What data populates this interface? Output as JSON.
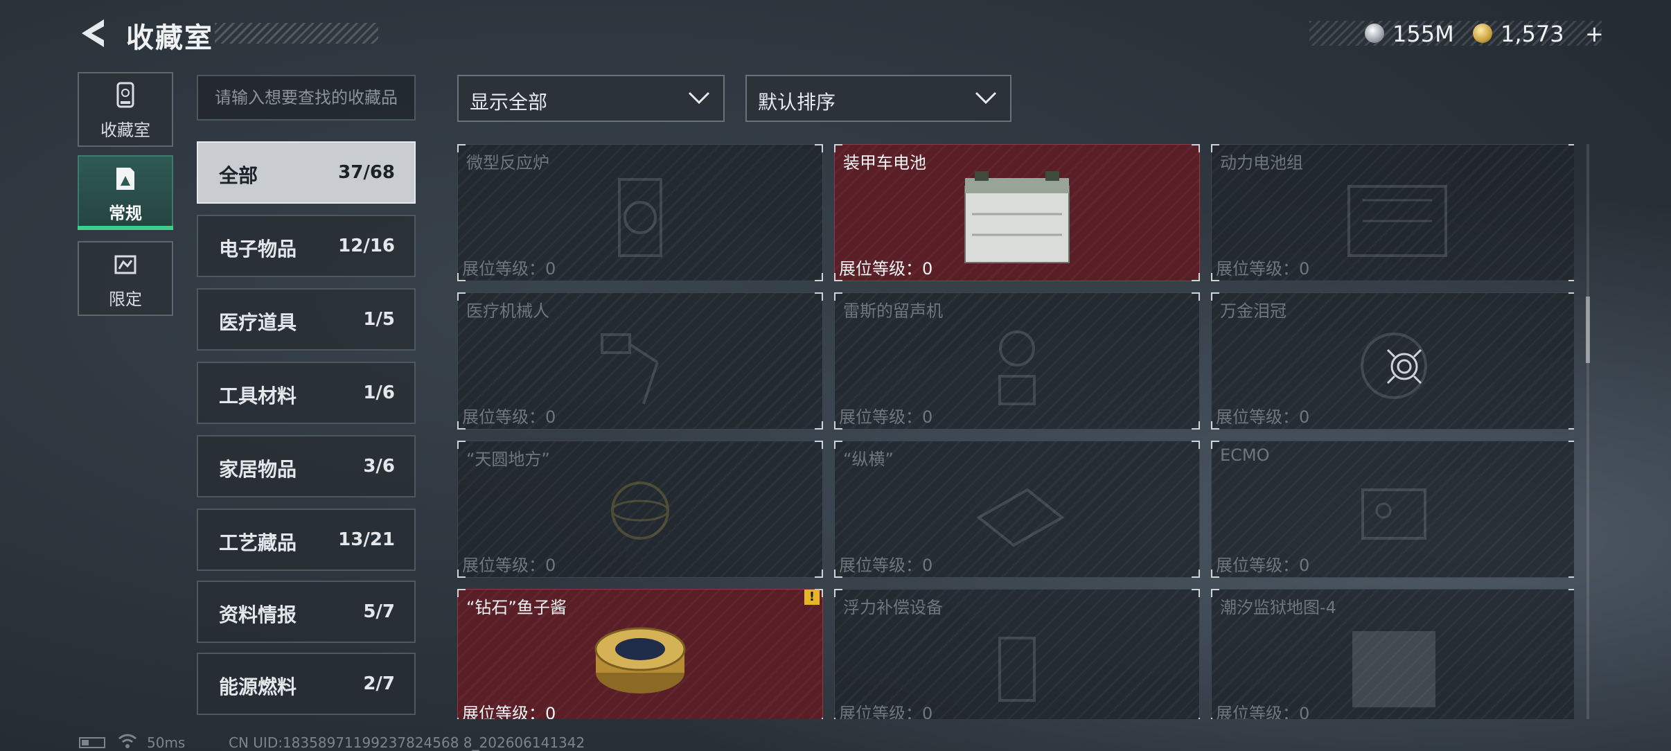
{
  "header": {
    "title": "收藏室",
    "currency_1": "155M",
    "currency_2": "1,573",
    "currency_plus": "+"
  },
  "mode_tabs": [
    {
      "label": "收藏室",
      "icon": "cabinet-icon"
    },
    {
      "label": "常规",
      "icon": "frame-icon",
      "active": true
    },
    {
      "label": "限定",
      "icon": "map-icon"
    }
  ],
  "search": {
    "placeholder": "请输入想要查找的收藏品"
  },
  "categories": [
    {
      "name": "全部",
      "count": "37/68",
      "active": true
    },
    {
      "name": "电子物品",
      "count": "12/16"
    },
    {
      "name": "医疗道具",
      "count": "1/5"
    },
    {
      "name": "工具材料",
      "count": "1/6"
    },
    {
      "name": "家居物品",
      "count": "3/6"
    },
    {
      "name": "工艺藏品",
      "count": "13/21"
    },
    {
      "name": "资料情报",
      "count": "5/7"
    },
    {
      "name": "能源燃料",
      "count": "2/7"
    }
  ],
  "filters": {
    "show": "显示全部",
    "sort": "默认排序"
  },
  "items": [
    {
      "name": "微型反应炉",
      "level": "展位等级：0",
      "owned": false
    },
    {
      "name": "装甲车电池",
      "level": "展位等级：0",
      "owned": true
    },
    {
      "name": "动力电池组",
      "level": "展位等级：0",
      "owned": false
    },
    {
      "name": "医疗机械人",
      "level": "展位等级：0",
      "owned": false
    },
    {
      "name": "雷斯的留声机",
      "level": "展位等级：0",
      "owned": false
    },
    {
      "name": "万金泪冠",
      "level": "展位等级：0",
      "owned": false
    },
    {
      "name": "“天圆地方”",
      "level": "展位等级：0",
      "owned": false
    },
    {
      "name": "“纵横”",
      "level": "展位等级：0",
      "owned": false
    },
    {
      "name": "ECMO",
      "level": "展位等级：0",
      "owned": false
    },
    {
      "name": "“钻石”鱼子酱",
      "level": "展位等级：0",
      "owned": true,
      "warning": "!"
    },
    {
      "name": "浮力补偿设备",
      "level": "展位等级：0",
      "owned": false
    },
    {
      "name": "潮汐监狱地图-4",
      "level": "展位等级：0",
      "owned": false
    }
  ],
  "status": {
    "ping": "50ms",
    "uid": "CN UID:18358971199237824568 8_202606141342"
  },
  "colors": {
    "owned_card": "#5a1f26",
    "active_accent": "#3ecf8e",
    "warning": "#e8b526"
  }
}
